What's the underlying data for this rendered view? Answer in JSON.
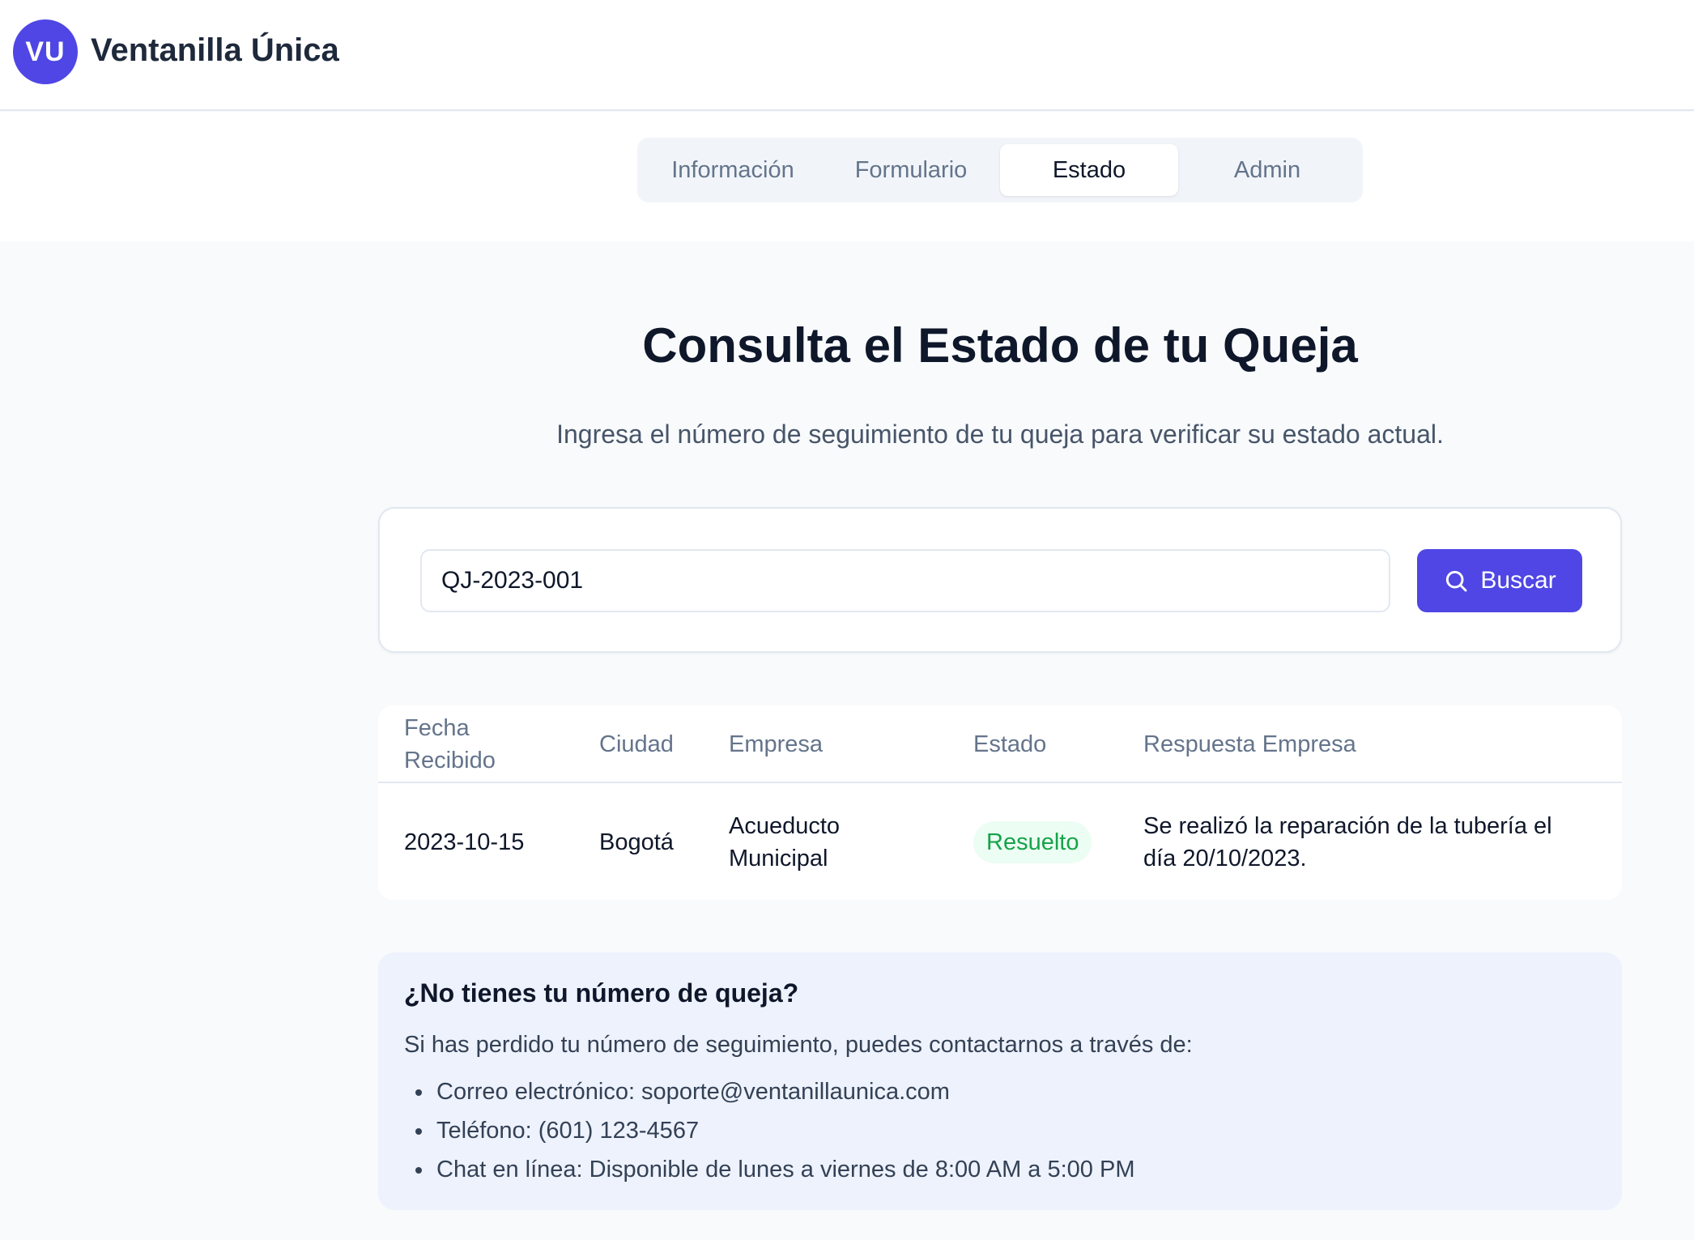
{
  "app": {
    "logo_initials": "VU",
    "title": "Ventanilla Única"
  },
  "tabs": [
    {
      "label": "Información",
      "active": false
    },
    {
      "label": "Formulario",
      "active": false
    },
    {
      "label": "Estado",
      "active": true
    },
    {
      "label": "Admin",
      "active": false
    }
  ],
  "page": {
    "title": "Consulta el Estado de tu Queja",
    "subtitle": "Ingresa el número de seguimiento de tu queja para verificar su estado actual."
  },
  "search": {
    "value": "QJ-2023-001",
    "button_label": "Buscar",
    "button_icon": "search-icon"
  },
  "results": {
    "columns": [
      "Fecha\nRecibido",
      "Ciudad",
      "Empresa",
      "Estado",
      "Respuesta Empresa"
    ],
    "rows": [
      {
        "fecha": "2023-10-15",
        "ciudad": "Bogotá",
        "empresa": "Acueducto\nMunicipal",
        "estado": "Resuelto",
        "respuesta": "Se realizó la reparación de la tubería el\ndía 20/10/2023."
      }
    ]
  },
  "help": {
    "title": "¿No tienes tu número de queja?",
    "text": "Si has perdido tu número de seguimiento, puedes contactarnos a través de:",
    "items": [
      "Correo electrónico: soporte@ventanillaunica.com",
      "Teléfono: (601) 123-4567",
      "Chat en línea: Disponible de lunes a viernes de 8:00 AM a 5:00 PM"
    ]
  },
  "colors": {
    "accent": "#4f46e5",
    "status_resolved": "#16a34a",
    "status_resolved_bg": "#ecfdf3",
    "help_bg": "#eef2fd"
  }
}
